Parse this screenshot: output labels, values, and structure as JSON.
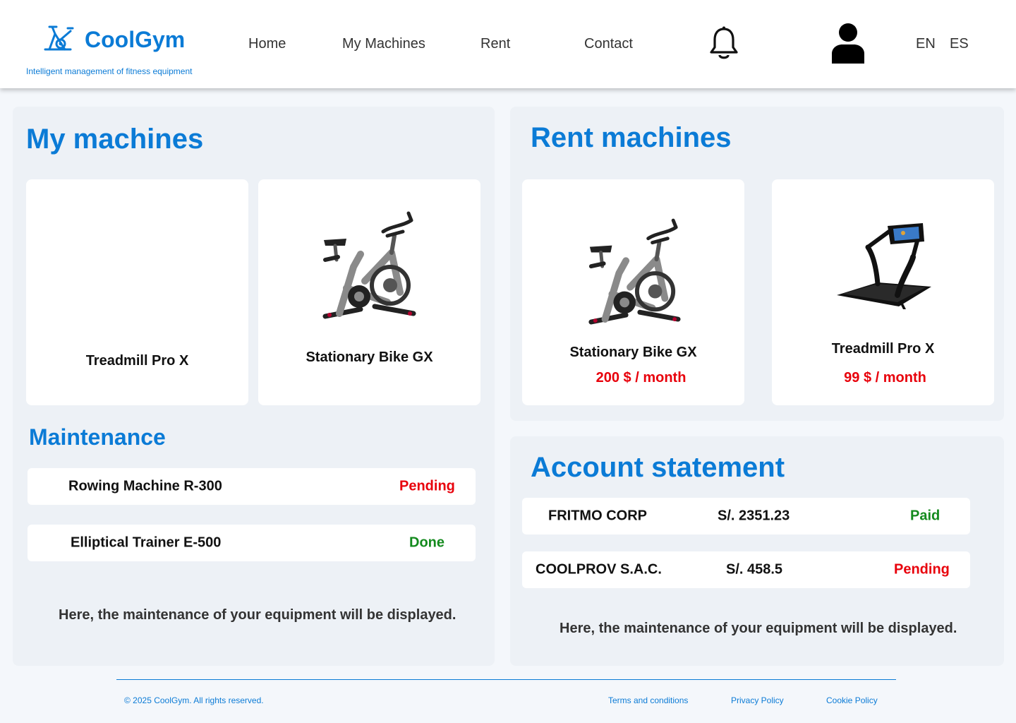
{
  "header": {
    "brand": "CoolGym",
    "tagline": "Intelligent management of fitness equipment",
    "nav": {
      "home": "Home",
      "my_machines": "My Machines",
      "rent": "Rent",
      "contact": "Contact"
    },
    "languages": [
      "EN",
      "ES"
    ]
  },
  "my_machines": {
    "title": "My machines",
    "cards": [
      {
        "name": "Treadmill Pro X",
        "image": "none"
      },
      {
        "name": "Stationary Bike GX",
        "image": "stationary-bike-icon"
      }
    ]
  },
  "maintenance": {
    "title": "Maintenance",
    "rows": [
      {
        "machine": "Rowing Machine R-300",
        "status": "Pending"
      },
      {
        "machine": "Elliptical Trainer E-500",
        "status": "Done"
      }
    ],
    "note": "Here, the maintenance of your equipment will be displayed."
  },
  "rent_machines": {
    "title": "Rent machines",
    "cards": [
      {
        "name": "Stationary Bike GX",
        "price": "200 $ / month",
        "image": "stationary-bike-icon"
      },
      {
        "name": "Treadmill Pro X",
        "price": "99 $ / month",
        "image": "treadmill-icon"
      }
    ]
  },
  "account_statement": {
    "title": "Account statement",
    "rows": [
      {
        "company": "FRITMO CORP",
        "amount": "S/. 2351.23",
        "status": "Paid"
      },
      {
        "company": "COOLPROV S.A.C.",
        "amount": "S/. 458.5",
        "status": "Pending"
      }
    ],
    "note": "Here, the maintenance of your equipment will be displayed."
  },
  "footer": {
    "copyright": "© 2025 CoolGym. All rights reserved.",
    "links": {
      "terms": "Terms and conditions",
      "privacy": "Privacy Policy",
      "cookie": "Cookie Policy"
    }
  },
  "colors": {
    "brand": "#0b7bd6",
    "pending": "#e8000b",
    "done": "#138a1d",
    "panel_bg": "#edf1f6"
  }
}
